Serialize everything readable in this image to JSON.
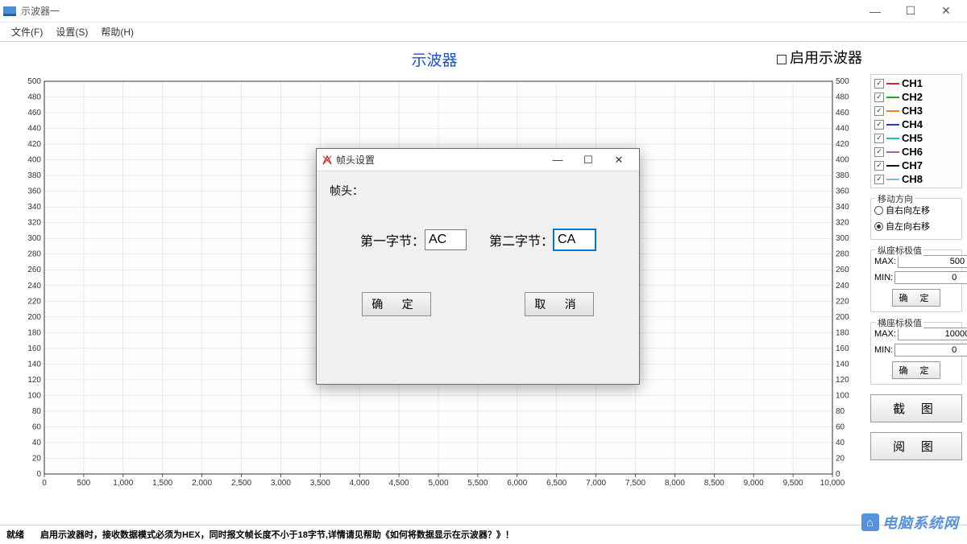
{
  "window": {
    "title": "示波器一",
    "min": "—",
    "max": "☐",
    "close": "✕"
  },
  "menu": {
    "file": "文件(F)",
    "settings": "设置(S)",
    "help": "帮助(H)"
  },
  "chart": {
    "title": "示波器",
    "enable_label": "启用示波器"
  },
  "chart_data": {
    "type": "line",
    "title": "示波器",
    "xlim": [
      0,
      10000
    ],
    "ylim": [
      0,
      500
    ],
    "x_ticks": [
      0,
      500,
      1000,
      1500,
      2000,
      2500,
      3000,
      3500,
      4000,
      4500,
      5000,
      5500,
      6000,
      6500,
      7000,
      7500,
      8000,
      8500,
      9000,
      9500,
      10000
    ],
    "y_ticks": [
      0,
      20,
      40,
      60,
      80,
      100,
      120,
      140,
      160,
      180,
      200,
      220,
      240,
      260,
      280,
      300,
      320,
      340,
      360,
      380,
      400,
      420,
      440,
      460,
      480,
      500
    ],
    "series": [
      {
        "name": "CH1",
        "color": "#d62728",
        "values": []
      },
      {
        "name": "CH2",
        "color": "#2ca02c",
        "values": []
      },
      {
        "name": "CH3",
        "color": "#ff7f0e",
        "values": []
      },
      {
        "name": "CH4",
        "color": "#1f3fbf",
        "values": []
      },
      {
        "name": "CH5",
        "color": "#17becf",
        "values": []
      },
      {
        "name": "CH6",
        "color": "#9467bd",
        "values": []
      },
      {
        "name": "CH7",
        "color": "#111111",
        "values": []
      },
      {
        "name": "CH8",
        "color": "#7fb8d8",
        "values": []
      }
    ]
  },
  "legend": [
    {
      "label": "CH1",
      "color": "#d62728",
      "checked": true
    },
    {
      "label": "CH2",
      "color": "#2ca02c",
      "checked": true
    },
    {
      "label": "CH3",
      "color": "#ff7f0e",
      "checked": true
    },
    {
      "label": "CH4",
      "color": "#1f3fbf",
      "checked": true
    },
    {
      "label": "CH5",
      "color": "#17becf",
      "checked": true
    },
    {
      "label": "CH6",
      "color": "#9467bd",
      "checked": true
    },
    {
      "label": "CH7",
      "color": "#111111",
      "checked": true
    },
    {
      "label": "CH8",
      "color": "#7fb8d8",
      "checked": true
    }
  ],
  "direction": {
    "title": "移动方向",
    "opt1": "自右向左移",
    "opt2": "自左向右移",
    "selected": 1
  },
  "ylimits": {
    "title": "纵座标极值",
    "max_label": "MAX:",
    "max_value": "500",
    "min_label": "MIN:",
    "min_value": "0",
    "confirm": "确 定"
  },
  "xlimits": {
    "title": "横座标极值",
    "max_label": "MAX:",
    "max_value": "10000",
    "min_label": "MIN:",
    "min_value": "0",
    "confirm": "确 定"
  },
  "buttons": {
    "screenshot": "截 图",
    "read": "阅 图"
  },
  "status": {
    "ready": "就绪",
    "hint": "启用示波器时，接收数据模式必须为HEX，同时报文帧长度不小于18字节,详情请见帮助《如何将数据显示在示波器？》！"
  },
  "dialog": {
    "title": "帧头设置",
    "header_label": "帧头：",
    "byte1_label": "第一字节：",
    "byte1_value": "AC",
    "byte2_label": "第二字节：",
    "byte2_value": "CA",
    "ok": "确  定",
    "cancel": "取  消",
    "min": "—",
    "max": "☐",
    "close": "✕"
  },
  "watermark": "电脑系统网"
}
